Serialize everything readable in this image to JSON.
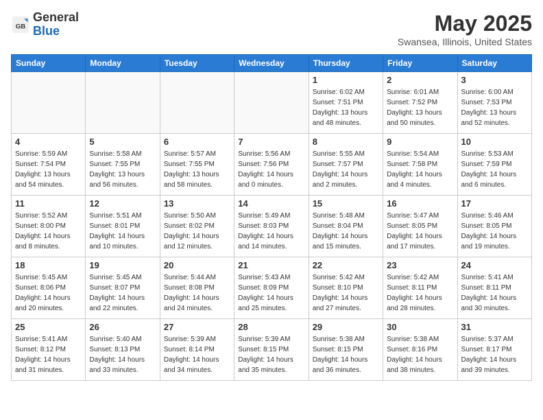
{
  "logo": {
    "general": "General",
    "blue": "Blue"
  },
  "header": {
    "month": "May 2025",
    "location": "Swansea, Illinois, United States"
  },
  "weekdays": [
    "Sunday",
    "Monday",
    "Tuesday",
    "Wednesday",
    "Thursday",
    "Friday",
    "Saturday"
  ],
  "weeks": [
    [
      {
        "day": "",
        "info": ""
      },
      {
        "day": "",
        "info": ""
      },
      {
        "day": "",
        "info": ""
      },
      {
        "day": "",
        "info": ""
      },
      {
        "day": "1",
        "info": "Sunrise: 6:02 AM\nSunset: 7:51 PM\nDaylight: 13 hours\nand 48 minutes."
      },
      {
        "day": "2",
        "info": "Sunrise: 6:01 AM\nSunset: 7:52 PM\nDaylight: 13 hours\nand 50 minutes."
      },
      {
        "day": "3",
        "info": "Sunrise: 6:00 AM\nSunset: 7:53 PM\nDaylight: 13 hours\nand 52 minutes."
      }
    ],
    [
      {
        "day": "4",
        "info": "Sunrise: 5:59 AM\nSunset: 7:54 PM\nDaylight: 13 hours\nand 54 minutes."
      },
      {
        "day": "5",
        "info": "Sunrise: 5:58 AM\nSunset: 7:55 PM\nDaylight: 13 hours\nand 56 minutes."
      },
      {
        "day": "6",
        "info": "Sunrise: 5:57 AM\nSunset: 7:55 PM\nDaylight: 13 hours\nand 58 minutes."
      },
      {
        "day": "7",
        "info": "Sunrise: 5:56 AM\nSunset: 7:56 PM\nDaylight: 14 hours\nand 0 minutes."
      },
      {
        "day": "8",
        "info": "Sunrise: 5:55 AM\nSunset: 7:57 PM\nDaylight: 14 hours\nand 2 minutes."
      },
      {
        "day": "9",
        "info": "Sunrise: 5:54 AM\nSunset: 7:58 PM\nDaylight: 14 hours\nand 4 minutes."
      },
      {
        "day": "10",
        "info": "Sunrise: 5:53 AM\nSunset: 7:59 PM\nDaylight: 14 hours\nand 6 minutes."
      }
    ],
    [
      {
        "day": "11",
        "info": "Sunrise: 5:52 AM\nSunset: 8:00 PM\nDaylight: 14 hours\nand 8 minutes."
      },
      {
        "day": "12",
        "info": "Sunrise: 5:51 AM\nSunset: 8:01 PM\nDaylight: 14 hours\nand 10 minutes."
      },
      {
        "day": "13",
        "info": "Sunrise: 5:50 AM\nSunset: 8:02 PM\nDaylight: 14 hours\nand 12 minutes."
      },
      {
        "day": "14",
        "info": "Sunrise: 5:49 AM\nSunset: 8:03 PM\nDaylight: 14 hours\nand 14 minutes."
      },
      {
        "day": "15",
        "info": "Sunrise: 5:48 AM\nSunset: 8:04 PM\nDaylight: 14 hours\nand 15 minutes."
      },
      {
        "day": "16",
        "info": "Sunrise: 5:47 AM\nSunset: 8:05 PM\nDaylight: 14 hours\nand 17 minutes."
      },
      {
        "day": "17",
        "info": "Sunrise: 5:46 AM\nSunset: 8:05 PM\nDaylight: 14 hours\nand 19 minutes."
      }
    ],
    [
      {
        "day": "18",
        "info": "Sunrise: 5:45 AM\nSunset: 8:06 PM\nDaylight: 14 hours\nand 20 minutes."
      },
      {
        "day": "19",
        "info": "Sunrise: 5:45 AM\nSunset: 8:07 PM\nDaylight: 14 hours\nand 22 minutes."
      },
      {
        "day": "20",
        "info": "Sunrise: 5:44 AM\nSunset: 8:08 PM\nDaylight: 14 hours\nand 24 minutes."
      },
      {
        "day": "21",
        "info": "Sunrise: 5:43 AM\nSunset: 8:09 PM\nDaylight: 14 hours\nand 25 minutes."
      },
      {
        "day": "22",
        "info": "Sunrise: 5:42 AM\nSunset: 8:10 PM\nDaylight: 14 hours\nand 27 minutes."
      },
      {
        "day": "23",
        "info": "Sunrise: 5:42 AM\nSunset: 8:11 PM\nDaylight: 14 hours\nand 28 minutes."
      },
      {
        "day": "24",
        "info": "Sunrise: 5:41 AM\nSunset: 8:11 PM\nDaylight: 14 hours\nand 30 minutes."
      }
    ],
    [
      {
        "day": "25",
        "info": "Sunrise: 5:41 AM\nSunset: 8:12 PM\nDaylight: 14 hours\nand 31 minutes."
      },
      {
        "day": "26",
        "info": "Sunrise: 5:40 AM\nSunset: 8:13 PM\nDaylight: 14 hours\nand 33 minutes."
      },
      {
        "day": "27",
        "info": "Sunrise: 5:39 AM\nSunset: 8:14 PM\nDaylight: 14 hours\nand 34 minutes."
      },
      {
        "day": "28",
        "info": "Sunrise: 5:39 AM\nSunset: 8:15 PM\nDaylight: 14 hours\nand 35 minutes."
      },
      {
        "day": "29",
        "info": "Sunrise: 5:38 AM\nSunset: 8:15 PM\nDaylight: 14 hours\nand 36 minutes."
      },
      {
        "day": "30",
        "info": "Sunrise: 5:38 AM\nSunset: 8:16 PM\nDaylight: 14 hours\nand 38 minutes."
      },
      {
        "day": "31",
        "info": "Sunrise: 5:37 AM\nSunset: 8:17 PM\nDaylight: 14 hours\nand 39 minutes."
      }
    ]
  ]
}
